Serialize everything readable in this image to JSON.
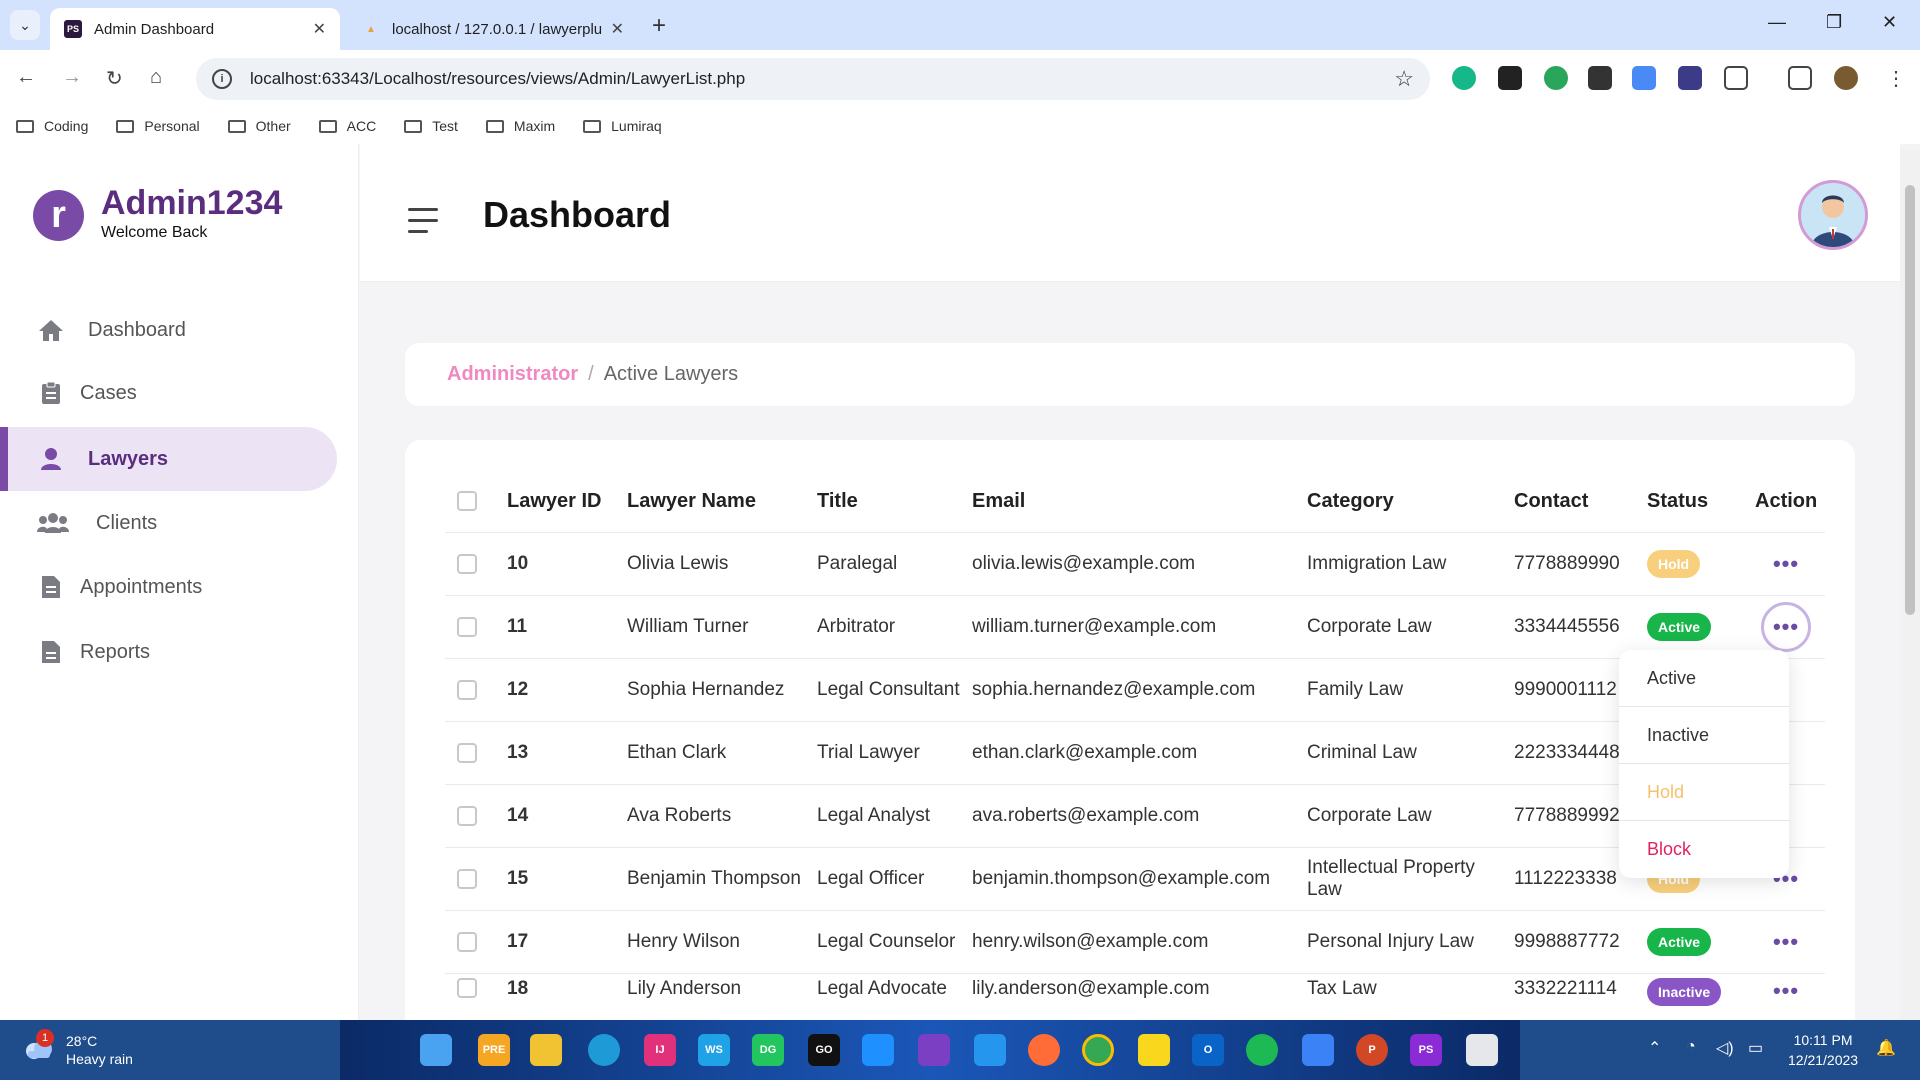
{
  "browser": {
    "tabs": [
      {
        "label": "Admin Dashboard",
        "active": true
      },
      {
        "label": "localhost / 127.0.0.1 / lawyerplu",
        "active": false
      }
    ],
    "url": "localhost:63343/Localhost/resources/views/Admin/LawyerList.php",
    "bookmarks": [
      "Coding",
      "Personal",
      "Other",
      "ACC",
      "Test",
      "Maxim",
      "Lumiraq"
    ]
  },
  "sidebar": {
    "brand": "Admin1234",
    "subtitle": "Welcome Back",
    "items": [
      {
        "label": "Dashboard",
        "icon": "home-icon"
      },
      {
        "label": "Cases",
        "icon": "clipboard-icon"
      },
      {
        "label": "Lawyers",
        "icon": "user-icon",
        "active": true
      },
      {
        "label": "Clients",
        "icon": "users-icon"
      },
      {
        "label": "Appointments",
        "icon": "file-icon"
      },
      {
        "label": "Reports",
        "icon": "document-icon"
      }
    ]
  },
  "header": {
    "title": "Dashboard"
  },
  "breadcrumb": {
    "root": "Administrator",
    "separator": "/",
    "current": "Active Lawyers"
  },
  "table": {
    "columns": [
      "Lawyer ID",
      "Lawyer Name",
      "Title",
      "Email",
      "Category",
      "Contact",
      "Status",
      "Action"
    ],
    "rows": [
      {
        "id": "10",
        "name": "Olivia Lewis",
        "title": "Paralegal",
        "email": "olivia.lewis@example.com",
        "category": "Immigration Law",
        "contact": "7778889990",
        "status": "Hold"
      },
      {
        "id": "11",
        "name": "William Turner",
        "title": "Arbitrator",
        "email": "william.turner@example.com",
        "category": "Corporate Law",
        "contact": "3334445556",
        "status": "Active"
      },
      {
        "id": "12",
        "name": "Sophia Hernandez",
        "title": "Legal Consultant",
        "email": "sophia.hernandez@example.com",
        "category": "Family Law",
        "contact": "9990001112",
        "status": ""
      },
      {
        "id": "13",
        "name": "Ethan Clark",
        "title": "Trial Lawyer",
        "email": "ethan.clark@example.com",
        "category": "Criminal Law",
        "contact": "2223334448",
        "status": ""
      },
      {
        "id": "14",
        "name": "Ava Roberts",
        "title": "Legal Analyst",
        "email": "ava.roberts@example.com",
        "category": "Corporate Law",
        "contact": "7778889992",
        "status": ""
      },
      {
        "id": "15",
        "name": "Benjamin Thompson",
        "title": "Legal Officer",
        "email": "benjamin.thompson@example.com",
        "category": "Intellectual Property Law",
        "contact": "1112223338",
        "status": "Hold"
      },
      {
        "id": "17",
        "name": "Henry Wilson",
        "title": "Legal Counselor",
        "email": "henry.wilson@example.com",
        "category": "Personal Injury Law",
        "contact": "9998887772",
        "status": "Active"
      },
      {
        "id": "18",
        "name": "Lily Anderson",
        "title": "Legal Advocate",
        "email": "lily.anderson@example.com",
        "category": "Tax Law",
        "contact": "3332221114",
        "status": "Inactive"
      }
    ]
  },
  "dropdown": {
    "items": [
      {
        "label": "Active",
        "color": "#333333"
      },
      {
        "label": "Inactive",
        "color": "#333333"
      },
      {
        "label": "Hold",
        "color": "#f6c06a"
      },
      {
        "label": "Block",
        "color": "#e0245e"
      }
    ]
  },
  "taskbar": {
    "weather_temp": "28°C",
    "weather_desc": "Heavy rain",
    "weather_badge": "1",
    "time": "10:11 PM",
    "date": "12/21/2023"
  },
  "colors": {
    "accent": "#7a4ba6",
    "pink": "#ef89c1",
    "active": "#17b54a",
    "hold": "#f8cf7c",
    "inactive": "#8a56c6"
  }
}
